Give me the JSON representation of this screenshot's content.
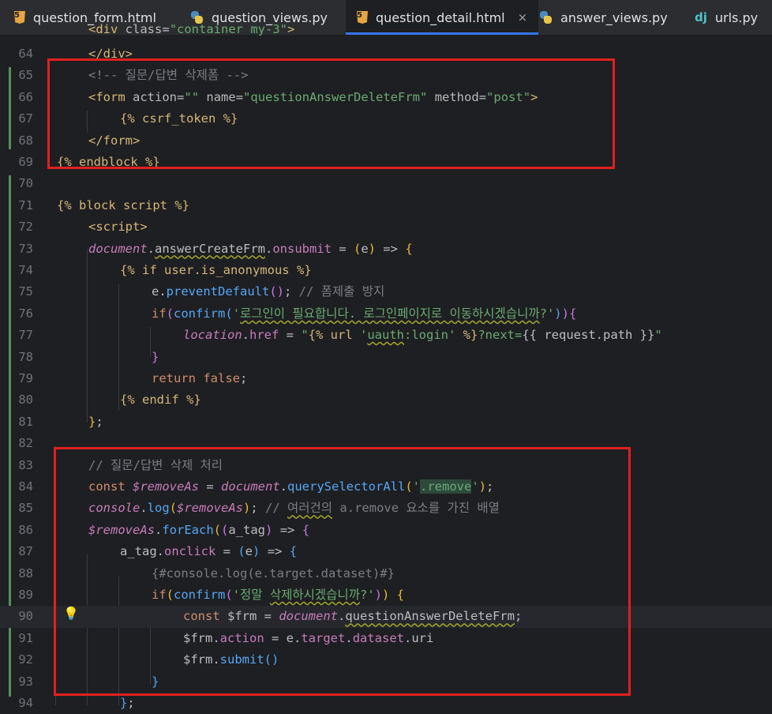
{
  "tabs": [
    {
      "label": "question_form.html",
      "icon": "html-icon",
      "active": false
    },
    {
      "label": "question_views.py",
      "icon": "python-icon",
      "active": false
    },
    {
      "label": "question_detail.html",
      "icon": "html-icon",
      "active": true,
      "close": "×"
    },
    {
      "label": "answer_views.py",
      "icon": "python-icon",
      "active": false
    },
    {
      "label": "urls.py",
      "icon": "django-icon",
      "active": false
    }
  ],
  "line_numbers": [
    "64",
    "65",
    "66",
    "67",
    "68",
    "69",
    "70",
    "71",
    "72",
    "73",
    "74",
    "75",
    "76",
    "77",
    "78",
    "79",
    "80",
    "81",
    "82",
    "83",
    "84",
    "85",
    "86",
    "87",
    "88",
    "89",
    "90",
    "91",
    "92",
    "93",
    "94"
  ],
  "colors": {
    "accent": "#3574f0",
    "annotation_box": "#e02020",
    "git_modified": "#549159"
  }
}
